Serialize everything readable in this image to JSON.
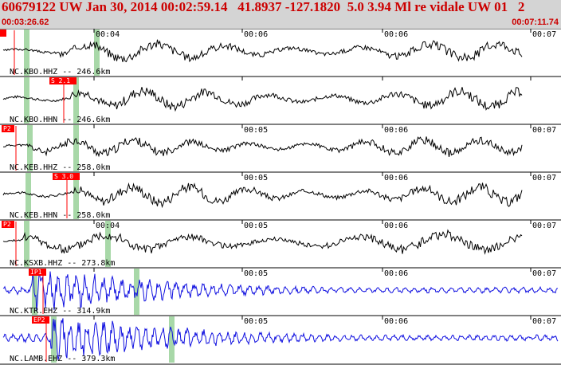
{
  "header": {
    "title": "60679122 UW Jan 30, 2014 00:02:59.14   41.8937 -127.1820  5.0 3.94 Ml re vidale UW 01   2",
    "start_time": "00:03:26.62",
    "end_time": "00:07:11.74"
  },
  "colors": {
    "header_bg": "#d4d4d4",
    "header_text": "#cc0000",
    "trace_black": "#000000",
    "trace_blue": "#1010e0",
    "pick_box": "#ff0000",
    "window_band": "#a8d8a8"
  },
  "traces": [
    {
      "label": "NC.KBO.HHZ -- 246.6km",
      "color": "black",
      "pick": "",
      "ticks": [
        "00:04",
        "00:06",
        "00:06",
        "00:07"
      ],
      "amp": 13,
      "onset": 0.12,
      "freq": 0.11,
      "seed": 3
    },
    {
      "label": "NC.KBO.HHN -- 246.6km",
      "color": "black",
      "pick": "S 2.1",
      "ticks": [
        "",
        "",
        "",
        ""
      ],
      "amp": 14,
      "onset": 0.14,
      "freq": 0.12,
      "seed": 7
    },
    {
      "label": "NC.KEB.HHZ -- 258.0km",
      "color": "black",
      "pick": "P2",
      "ticks": [
        "",
        "00:05",
        "00:06",
        "00:07"
      ],
      "amp": 12,
      "onset": 0.05,
      "freq": 0.13,
      "seed": 11
    },
    {
      "label": "NC.KEB.HHN -- 258.0km",
      "color": "black",
      "pick": "S 3.0",
      "ticks": [
        "",
        "00:05",
        "00:06",
        "00:07"
      ],
      "amp": 14,
      "onset": 0.15,
      "freq": 0.13,
      "seed": 17
    },
    {
      "label": "NC.KSXB.HHZ -- 273.8km",
      "color": "black",
      "pick": "P2",
      "ticks": [
        "00:04",
        "00:05",
        "00:06",
        "00:07"
      ],
      "amp": 14,
      "onset": 0.04,
      "freq": 0.09,
      "seed": 23
    },
    {
      "label": "NC.KTR.EHZ -- 314.9km",
      "color": "blue",
      "pick": "IP1",
      "ticks": [
        "",
        "00:05",
        "00:06",
        "00:07"
      ],
      "amp": 20,
      "onset": 0.06,
      "freq": 0.55,
      "seed": 29
    },
    {
      "label": "NC.LAMB.EHZ -- 379.3km",
      "color": "blue",
      "pick": "EP2",
      "ticks": [
        "",
        "00:05",
        "00:06",
        "00:07"
      ],
      "amp": 20,
      "onset": 0.1,
      "freq": 0.6,
      "seed": 31
    }
  ]
}
